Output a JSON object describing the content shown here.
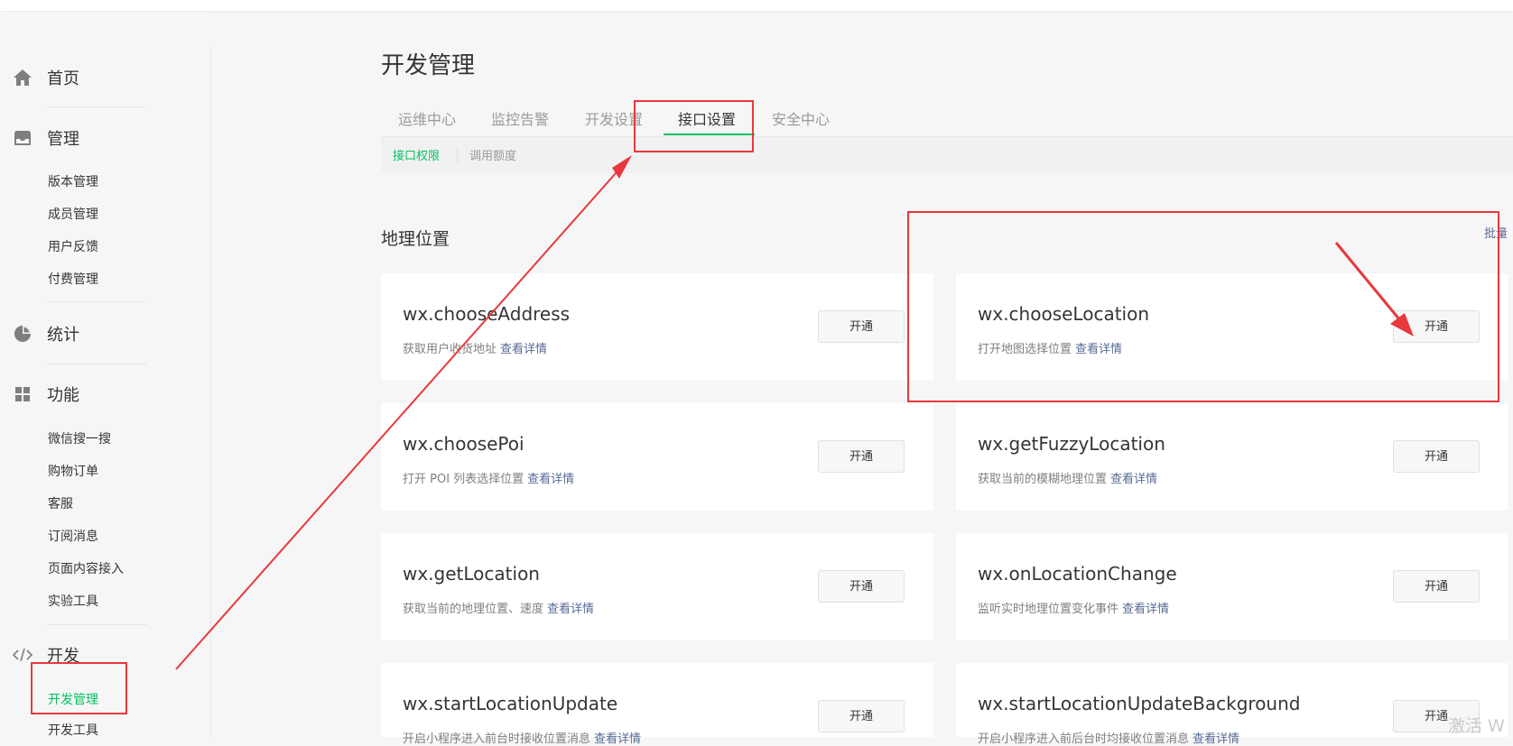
{
  "sidebar": {
    "groups": [
      {
        "label": "首页",
        "icon": "home-icon"
      },
      {
        "label": "管理",
        "icon": "inbox-icon",
        "items": [
          "版本管理",
          "成员管理",
          "用户反馈",
          "付费管理"
        ]
      },
      {
        "label": "统计",
        "icon": "pie-chart-icon"
      },
      {
        "label": "功能",
        "icon": "grid-icon",
        "items": [
          "微信搜一搜",
          "购物订单",
          "客服",
          "订阅消息",
          "页面内容接入",
          "实验工具"
        ]
      },
      {
        "label": "开发",
        "icon": "code-icon",
        "items": [
          "开发管理",
          "开发工具"
        ]
      }
    ],
    "active_item": "开发管理"
  },
  "main": {
    "title": "开发管理",
    "tabs": [
      "运维中心",
      "监控告警",
      "开发设置",
      "接口设置",
      "安全中心"
    ],
    "active_tab": "接口设置",
    "subtabs": [
      "接口权限",
      "调用额度"
    ],
    "active_subtab": "接口权限",
    "section_title": "地理位置",
    "batch_link": "批量",
    "detail_link": "查看详情",
    "open_label": "开通",
    "apis": [
      {
        "name": "wx.chooseAddress",
        "desc": "获取用户收货地址"
      },
      {
        "name": "wx.chooseLocation",
        "desc": "打开地图选择位置"
      },
      {
        "name": "wx.choosePoi",
        "desc": "打开 POI 列表选择位置"
      },
      {
        "name": "wx.getFuzzyLocation",
        "desc": "获取当前的模糊地理位置"
      },
      {
        "name": "wx.getLocation",
        "desc": "获取当前的地理位置、速度"
      },
      {
        "name": "wx.onLocationChange",
        "desc": "监听实时地理位置变化事件"
      },
      {
        "name": "wx.startLocationUpdate",
        "desc": "开启小程序进入前台时接收位置消息"
      },
      {
        "name": "wx.startLocationUpdateBackground",
        "desc": "开启小程序进入前后台时均接收位置消息"
      }
    ]
  },
  "watermark": "激活 W",
  "colors": {
    "accent": "#07c160",
    "link": "#576b95",
    "annotation": "#e8383d",
    "background": "#f6f6f6"
  }
}
